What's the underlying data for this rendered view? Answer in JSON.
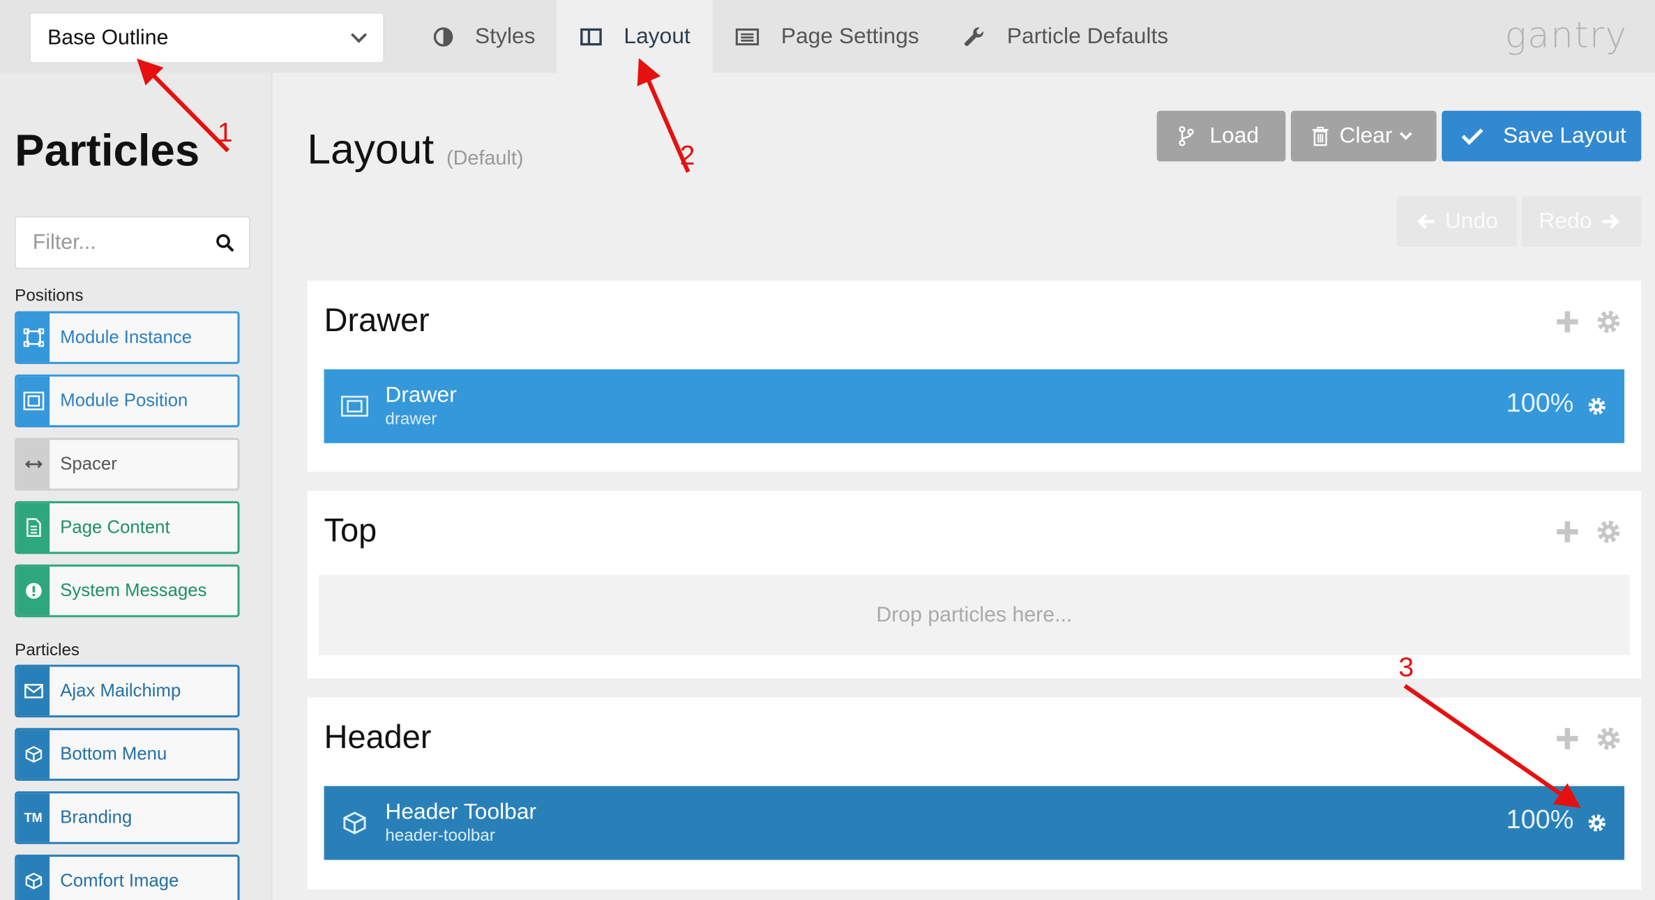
{
  "topbar": {
    "outline_select": "Base Outline",
    "tabs": [
      {
        "label": "Styles",
        "icon": "contrast-icon"
      },
      {
        "label": "Layout",
        "icon": "columns-icon"
      },
      {
        "label": "Page Settings",
        "icon": "list-icon"
      },
      {
        "label": "Particle Defaults",
        "icon": "wrench-icon"
      }
    ],
    "active_tab": "Layout",
    "brand": "gantry"
  },
  "sidebar": {
    "title": "Particles",
    "filter_placeholder": "Filter...",
    "positions_label": "Positions",
    "positions": [
      {
        "label": "Module Instance",
        "icon": "module-instance-icon",
        "color": "blue"
      },
      {
        "label": "Module Position",
        "icon": "module-position-icon",
        "color": "blue"
      },
      {
        "label": "Spacer",
        "icon": "spacer-icon",
        "color": "grey"
      },
      {
        "label": "Page Content",
        "icon": "document-icon",
        "color": "green"
      },
      {
        "label": "System Messages",
        "icon": "alert-icon",
        "color": "green"
      }
    ],
    "particles_label": "Particles",
    "particles": [
      {
        "label": "Ajax Mailchimp",
        "icon": "envelope-icon"
      },
      {
        "label": "Bottom Menu",
        "icon": "cube-icon"
      },
      {
        "label": "Branding",
        "icon": "trademark-icon",
        "glyph": "TM"
      },
      {
        "label": "Comfort Image",
        "icon": "cube-icon"
      }
    ]
  },
  "main": {
    "title": "Layout",
    "subtitle": "(Default)",
    "load_label": "Load",
    "clear_label": "Clear",
    "save_label": "Save Layout",
    "undo_label": "Undo",
    "redo_label": "Redo",
    "sections": {
      "drawer": {
        "title": "Drawer",
        "block": {
          "name": "Drawer",
          "key": "drawer",
          "size": "100%"
        }
      },
      "top": {
        "title": "Top",
        "dropzone": "Drop particles here..."
      },
      "header": {
        "title": "Header",
        "block": {
          "name": "Header Toolbar",
          "key": "header-toolbar",
          "size": "100%"
        }
      }
    }
  },
  "annotations": {
    "n1": "1",
    "n2": "2",
    "n3": "3"
  },
  "colors": {
    "accent_blue": "#3498db",
    "dark_blue": "#2980b9",
    "save_blue": "#3189d1",
    "green": "#2ea67e",
    "annotation_red": "#e61010"
  }
}
